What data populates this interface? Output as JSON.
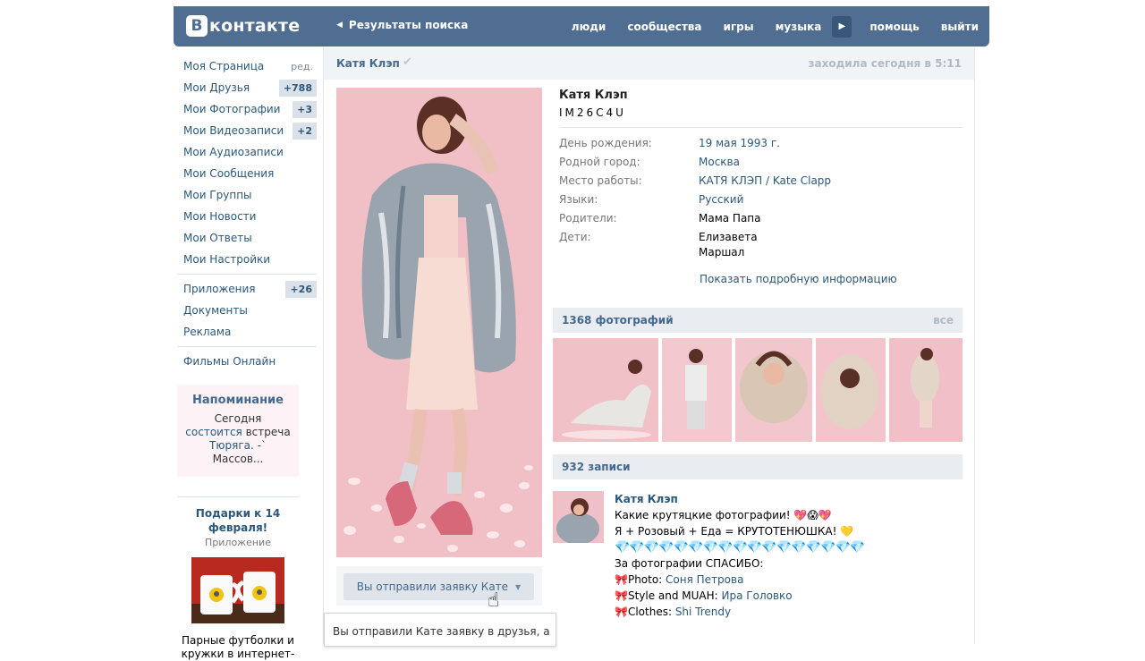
{
  "header": {
    "logo_letter": "В",
    "logo_text": "контакте",
    "back_label": "Результаты поиска",
    "nav": [
      "люди",
      "сообщества",
      "игры",
      "музыка",
      "помощь",
      "выйти"
    ]
  },
  "left_menu": {
    "items": [
      {
        "label": "Моя Страница",
        "extra": "ред."
      },
      {
        "label": "Мои Друзья",
        "count": "+788"
      },
      {
        "label": "Мои Фотографии",
        "count": "+3"
      },
      {
        "label": "Мои Видеозаписи",
        "count": "+2"
      },
      {
        "label": "Мои Аудиозаписи"
      },
      {
        "label": "Мои Сообщения"
      },
      {
        "label": "Мои Группы"
      },
      {
        "label": "Мои Новости"
      },
      {
        "label": "Мои Ответы"
      },
      {
        "label": "Мои Настройки"
      }
    ],
    "items2": [
      {
        "label": "Приложения",
        "count": "+26"
      },
      {
        "label": "Документы"
      },
      {
        "label": "Реклама"
      }
    ],
    "items3": [
      {
        "label": "Фильмы Онлайн"
      }
    ]
  },
  "reminder": {
    "title": "Напоминание",
    "text1": "Сегодня ",
    "link1": "состоится",
    "text2": " встреча ",
    "link2": "Тюряга. -`",
    "text3": " Массов..."
  },
  "gift": {
    "title": "Подарки к 14 февраля!",
    "subtitle": "Приложение",
    "desc": "Парные футболки и кружки в интернет-"
  },
  "profile": {
    "header_name": "Катя Клэп",
    "last_seen": "заходила сегодня в 5:11",
    "name": "Катя Клэп",
    "status": "IM26C4U",
    "fields": [
      {
        "k": "День рождения:",
        "v": "19 мая 1993 г.",
        "link": true
      },
      {
        "k": "Родной город:",
        "v": "Москва",
        "link": true
      },
      {
        "k": "Место работы:",
        "v": "КАТЯ КЛЭП / Kate Clapp",
        "link": true
      },
      {
        "k": "Языки:",
        "v": "Русский",
        "link": true
      },
      {
        "k": "Родители:",
        "v": "Мама Папа",
        "link": false
      },
      {
        "k": "Дети:",
        "v": "Елизавета",
        "v2": "Маршал",
        "link": false
      }
    ],
    "more": "Показать подробную информацию",
    "request_button": "Вы отправили заявку Кате",
    "tooltip": "Вы отправили Кате заявку в друзья, а"
  },
  "photos": {
    "title": "1368 фотографий",
    "all": "все"
  },
  "wall": {
    "title": "932 записи",
    "post": {
      "author": "Катя Клэп",
      "line1": "Какие крутяцкие фотографии! 💖😱💖",
      "line2": "Я + Розовый + Еда = КРУТОТЕНЮШКА! 💛",
      "diamonds": "💎💎💎💎💎💎💎💎💎💎💎💎💎💎💎💎💎",
      "line3": "За фотографии СПАСИБО:",
      "c1_label": "Photo: ",
      "c1_value": "Соня Петрова",
      "c2_label": "Style and MUAH: ",
      "c2_value": "Ира Головко",
      "c3_label": "Clothes: ",
      "c3_value": "Shi Trendy"
    }
  }
}
